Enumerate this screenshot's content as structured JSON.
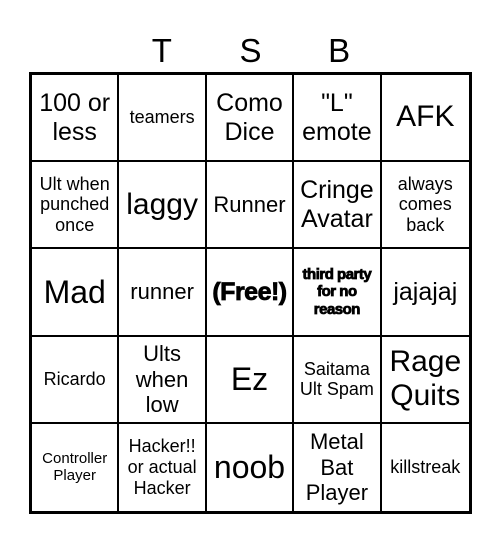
{
  "header": {
    "letters": [
      "",
      "T",
      "S",
      "B",
      ""
    ]
  },
  "board": {
    "rows": [
      [
        {
          "text": "100 or less",
          "style": "fs-lg"
        },
        {
          "text": "teamers",
          "style": "fs-sm"
        },
        {
          "text": "Como Dice",
          "style": "fs-lg"
        },
        {
          "text": "\"L\" emote",
          "style": "fs-lg"
        },
        {
          "text": "AFK",
          "style": "fs-xl"
        }
      ],
      [
        {
          "text": "Ult when punched once",
          "style": "fs-sm"
        },
        {
          "text": "laggy",
          "style": "fs-xl"
        },
        {
          "text": "Runner",
          "style": "fs-md"
        },
        {
          "text": "Cringe Avatar",
          "style": "fs-lg"
        },
        {
          "text": "always comes back",
          "style": "fs-sm"
        }
      ],
      [
        {
          "text": "Mad",
          "style": "fs-xxl"
        },
        {
          "text": "runner",
          "style": "fs-md"
        },
        {
          "text": "(Free!)",
          "style": "fs-lg bold-heavy"
        },
        {
          "text": "third party for no reason",
          "style": "fs-xs bold-heavy"
        },
        {
          "text": "jajajaj",
          "style": "fs-lg"
        }
      ],
      [
        {
          "text": "Ricardo",
          "style": "fs-sm"
        },
        {
          "text": "Ults when low",
          "style": "fs-md"
        },
        {
          "text": "Ez",
          "style": "fs-xxl"
        },
        {
          "text": "Saitama Ult Spam",
          "style": "fs-sm"
        },
        {
          "text": "Rage Quits",
          "style": "fs-xl"
        }
      ],
      [
        {
          "text": "Controller Player",
          "style": "fs-xs"
        },
        {
          "text": "Hacker!! or actual Hacker",
          "style": "fs-sm"
        },
        {
          "text": "noob",
          "style": "fs-xxl"
        },
        {
          "text": "Metal Bat Player",
          "style": "fs-md"
        },
        {
          "text": "killstreak",
          "style": "fs-sm"
        }
      ]
    ]
  }
}
